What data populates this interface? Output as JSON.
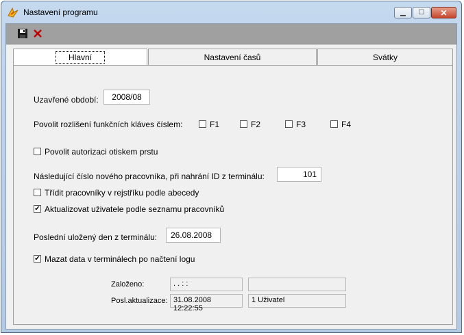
{
  "window": {
    "title": "Nastavení programu"
  },
  "toolbar": {
    "save_icon": "floppy-disk",
    "delete_icon": "red-x"
  },
  "tabs": [
    {
      "label": "Hlavní"
    },
    {
      "label": "Nastavení časů"
    },
    {
      "label": "Svátky"
    }
  ],
  "main": {
    "closed_period": {
      "label": "Uzavřené období:",
      "value": "2008/08"
    },
    "function_keys": {
      "label": "Povolit rozlišení funkčních kláves číslem:",
      "options": [
        {
          "label": "F1",
          "checked": ""
        },
        {
          "label": "F2",
          "checked": ""
        },
        {
          "label": "F3",
          "checked": ""
        },
        {
          "label": "F4",
          "checked": ""
        }
      ]
    },
    "fingerprint": {
      "label": "Povolit autorizaci otiskem prstu",
      "checked": ""
    },
    "next_employee_number": {
      "label": "Následující číslo nového pracovníka, při nahrání ID z terminálu:",
      "value": "101"
    },
    "sort_alpha": {
      "label": "Třídit pracovníky v rejstříku podle abecedy",
      "checked": ""
    },
    "update_users": {
      "label": "Aktualizovat uživatele podle seznamu pracovníků",
      "checked": "✔"
    },
    "last_saved_day": {
      "label": "Poslední uložený den z terminálu:",
      "value": "26.08.2008"
    },
    "delete_terminal_data": {
      "label": "Mazat data v terminálech po načtení logu",
      "checked": "✔"
    }
  },
  "footer": {
    "created": {
      "label": "Založeno:",
      "date": " .  .      :  :",
      "user": ""
    },
    "last_update": {
      "label": "Posl.aktualizace:",
      "date": "31.08.2008 12:22:55",
      "user": "1 Uživatel"
    }
  }
}
